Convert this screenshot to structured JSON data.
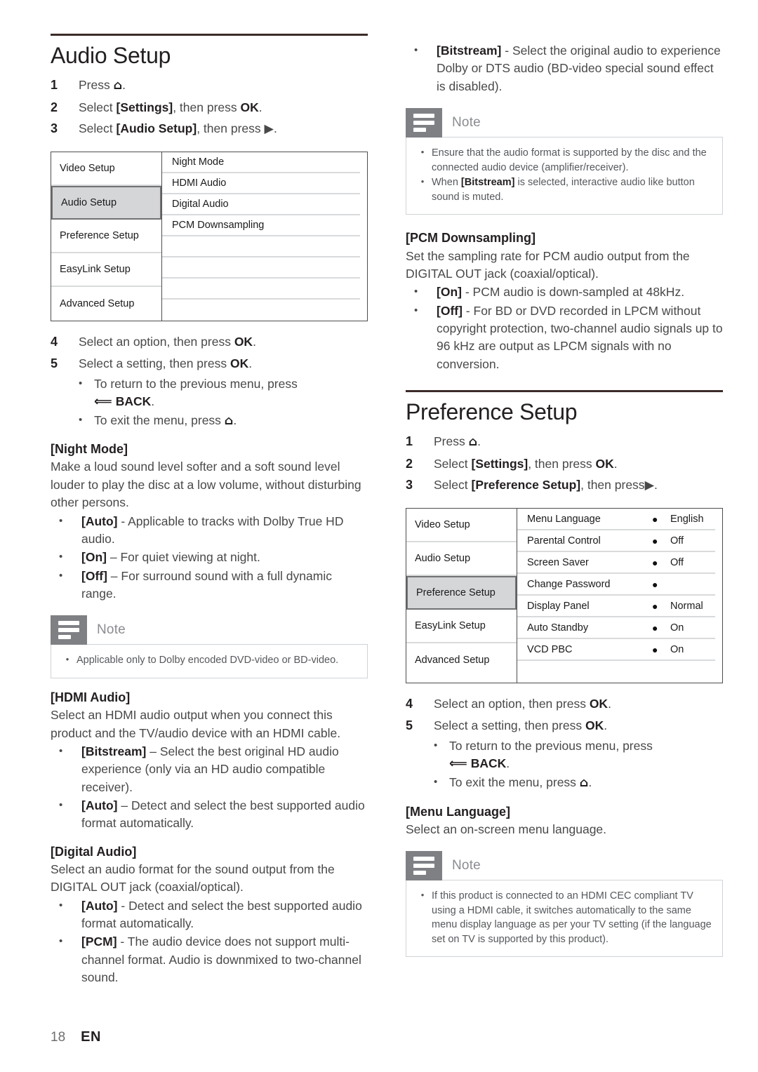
{
  "footer": {
    "page_number": "18",
    "language_code": "EN"
  },
  "icons": {
    "home": "⌂",
    "home_label": "home-icon",
    "right_arrow": "▶",
    "back_arrow": "⇦",
    "bullet": "•",
    "radio": "●"
  },
  "left_column": {
    "section": {
      "title": "Audio Setup",
      "steps": [
        {
          "num": "1",
          "parts": [
            {
              "t": "Press ",
              "b": false
            },
            {
              "t": "HOME_ICON",
              "b": false,
              "icon": "home"
            },
            {
              "t": ".",
              "b": false
            }
          ]
        },
        {
          "num": "2",
          "parts": [
            {
              "t": "Select ",
              "b": false
            },
            {
              "t": "[Settings]",
              "b": true
            },
            {
              "t": ", then press ",
              "b": false
            },
            {
              "t": "OK",
              "b": true
            },
            {
              "t": ".",
              "b": false
            }
          ]
        },
        {
          "num": "3",
          "parts": [
            {
              "t": "Select ",
              "b": false
            },
            {
              "t": "[Audio Setup]",
              "b": true
            },
            {
              "t": ", then press ",
              "b": false
            },
            {
              "t": "ARROW_ICON",
              "b": false,
              "icon": "right_arrow"
            },
            {
              "t": ".",
              "b": false
            }
          ]
        }
      ]
    },
    "menu": {
      "left_items": [
        {
          "label": "Video Setup",
          "selected": false
        },
        {
          "label": "Audio Setup",
          "selected": true
        },
        {
          "label": "Preference Setup",
          "selected": false
        },
        {
          "label": "EasyLink Setup",
          "selected": false
        },
        {
          "label": "Advanced Setup",
          "selected": false
        }
      ],
      "rows": [
        {
          "name": "Night Mode",
          "value": "",
          "bullet": ""
        },
        {
          "name": "HDMI Audio",
          "value": "",
          "bullet": ""
        },
        {
          "name": "Digital Audio",
          "value": "",
          "bullet": ""
        },
        {
          "name": "PCM Downsampling",
          "value": "",
          "bullet": ""
        },
        {
          "name": "",
          "value": "",
          "bullet": ""
        },
        {
          "name": "",
          "value": "",
          "bullet": ""
        },
        {
          "name": "",
          "value": "",
          "bullet": ""
        },
        {
          "name": "",
          "value": "",
          "bullet": ""
        }
      ]
    },
    "steps_45": [
      {
        "num": "4",
        "parts": [
          {
            "t": "Select an option, then press ",
            "b": false
          },
          {
            "t": "OK",
            "b": true
          },
          {
            "t": ".",
            "b": false
          }
        ]
      },
      {
        "num": "5",
        "parts": [
          {
            "t": "Select a setting, then press ",
            "b": false
          },
          {
            "t": "OK",
            "b": true
          },
          {
            "t": ".",
            "b": false
          }
        ]
      }
    ],
    "sub_bullets": [
      {
        "parts": [
          {
            "t": "To return to the previous menu, press ",
            "b": false
          },
          {
            "t": "BACK_LINE",
            "b": false,
            "break": true
          }
        ]
      },
      {
        "parts": [
          {
            "t": "To exit the menu, press ",
            "b": false
          },
          {
            "t": "HOME_ICON",
            "b": false,
            "icon": "home"
          },
          {
            "t": ".",
            "b": false
          }
        ]
      }
    ],
    "back_label": "BACK",
    "night_mode": {
      "heading": "[Night Mode]",
      "body": "Make a loud sound level softer and a soft sound level louder to play the disc at a low volume, without disturbing other persons.",
      "options": [
        {
          "key": "[Auto]",
          "sep": " - ",
          "text": "Applicable to tracks with Dolby True HD audio."
        },
        {
          "key": "[On]",
          "sep": " – ",
          "text": "For quiet viewing at night."
        },
        {
          "key": "[Off]",
          "sep": " – ",
          "text": "For surround sound with a full dynamic range."
        }
      ]
    },
    "note1": {
      "label": "Note",
      "items": [
        {
          "pre": "Applicable only to Dolby encoded DVD-video or BD-video.",
          "bold": "",
          "post": ""
        }
      ]
    },
    "hdmi_audio": {
      "heading": "[HDMI Audio]",
      "body": "Select an HDMI audio output when you connect this product and the TV/audio device with an HDMI cable.",
      "options": [
        {
          "key": "[Bitstream]",
          "sep": " – ",
          "text": "Select the best original HD audio experience (only via an HD audio compatible receiver)."
        },
        {
          "key": "[Auto]",
          "sep": " – ",
          "text": "Detect and select the best supported audio format automatically."
        }
      ]
    },
    "digital_audio": {
      "heading": "[Digital Audio]",
      "body": "Select an audio format for the sound output from the DIGITAL OUT jack (coaxial/optical).",
      "options": [
        {
          "key": "[Auto]",
          "sep": " - ",
          "text": "Detect and select the best supported audio format automatically."
        },
        {
          "key": "[PCM]",
          "sep": " - ",
          "text": "The audio device does not support multi-channel format. Audio is downmixed to two-channel sound."
        }
      ]
    }
  },
  "right_column": {
    "top_bullet": {
      "key": "[Bitstream]",
      "sep": " - ",
      "text": "Select the original audio to experience Dolby or DTS audio (BD-video special sound effect is disabled)."
    },
    "note_audio": {
      "label": "Note",
      "items": [
        {
          "pre": "Ensure that the audio format is supported by the disc and the connected audio device (amplifier/receiver).",
          "bold": "",
          "post": ""
        },
        {
          "pre": "When ",
          "bold": "[Bitstream]",
          "post": " is selected, interactive audio like button sound is muted."
        }
      ]
    },
    "pcm_downsampling": {
      "heading": "[PCM Downsampling]",
      "body": "Set the sampling rate for PCM audio output from the DIGITAL OUT jack (coaxial/optical).",
      "options": [
        {
          "key": "[On]",
          "sep": " - ",
          "text": "PCM audio is down-sampled at 48kHz."
        },
        {
          "key": "[Off]",
          "sep": " - ",
          "text": "For BD or DVD recorded in LPCM without copyright protection, two-channel audio signals up to 96 kHz are output as LPCM signals with no conversion."
        }
      ]
    },
    "section": {
      "title": "Preference Setup",
      "steps": [
        {
          "num": "1",
          "parts": [
            {
              "t": "Press ",
              "b": false
            },
            {
              "t": "HOME_ICON",
              "b": false,
              "icon": "home"
            },
            {
              "t": ".",
              "b": false
            }
          ]
        },
        {
          "num": "2",
          "parts": [
            {
              "t": "Select ",
              "b": false
            },
            {
              "t": "[Settings]",
              "b": true
            },
            {
              "t": ", then press ",
              "b": false
            },
            {
              "t": "OK",
              "b": true
            },
            {
              "t": ".",
              "b": false
            }
          ]
        },
        {
          "num": "3",
          "parts": [
            {
              "t": "Select ",
              "b": false
            },
            {
              "t": "[Preference Setup]",
              "b": true
            },
            {
              "t": ", then press",
              "b": false
            },
            {
              "t": "ARROW_ICON",
              "b": false,
              "icon": "right_arrow"
            },
            {
              "t": ".",
              "b": false
            }
          ]
        }
      ]
    },
    "menu": {
      "left_items": [
        {
          "label": "Video Setup",
          "selected": false
        },
        {
          "label": "Audio Setup",
          "selected": false
        },
        {
          "label": "Preference Setup",
          "selected": true
        },
        {
          "label": "EasyLink Setup",
          "selected": false
        },
        {
          "label": "Advanced Setup",
          "selected": false
        }
      ],
      "rows": [
        {
          "name": "Menu Language",
          "bullet": "●",
          "value": "English"
        },
        {
          "name": "Parental Control",
          "bullet": "●",
          "value": "Off"
        },
        {
          "name": "Screen Saver",
          "bullet": "●",
          "value": "Off"
        },
        {
          "name": "Change Password",
          "bullet": "●",
          "value": ""
        },
        {
          "name": "Display Panel",
          "bullet": "●",
          "value": "Normal"
        },
        {
          "name": "Auto Standby",
          "bullet": "●",
          "value": "On"
        },
        {
          "name": "VCD PBC",
          "bullet": "●",
          "value": "On"
        },
        {
          "name": "",
          "bullet": "",
          "value": ""
        }
      ]
    },
    "steps_45": [
      {
        "num": "4",
        "parts": [
          {
            "t": "Select an option, then press ",
            "b": false
          },
          {
            "t": "OK",
            "b": true
          },
          {
            "t": ".",
            "b": false
          }
        ]
      },
      {
        "num": "5",
        "parts": [
          {
            "t": "Select a setting, then press ",
            "b": false
          },
          {
            "t": "OK",
            "b": true
          },
          {
            "t": ".",
            "b": false
          }
        ]
      }
    ],
    "back_label": "BACK",
    "sub_bullets": [
      {
        "text": "To return to the previous menu, press"
      },
      {
        "text": "To exit the menu, press"
      }
    ],
    "menu_language": {
      "heading": "[Menu Language]",
      "body": "Select an on-screen menu language."
    },
    "note_lang": {
      "label": "Note",
      "items": [
        {
          "pre": "If this product is connected to an HDMI CEC compliant TV using a HDMI cable, it switches automatically to the same menu display language as per your TV setting (if the language set on TV is supported by this product).",
          "bold": "",
          "post": ""
        }
      ]
    }
  }
}
